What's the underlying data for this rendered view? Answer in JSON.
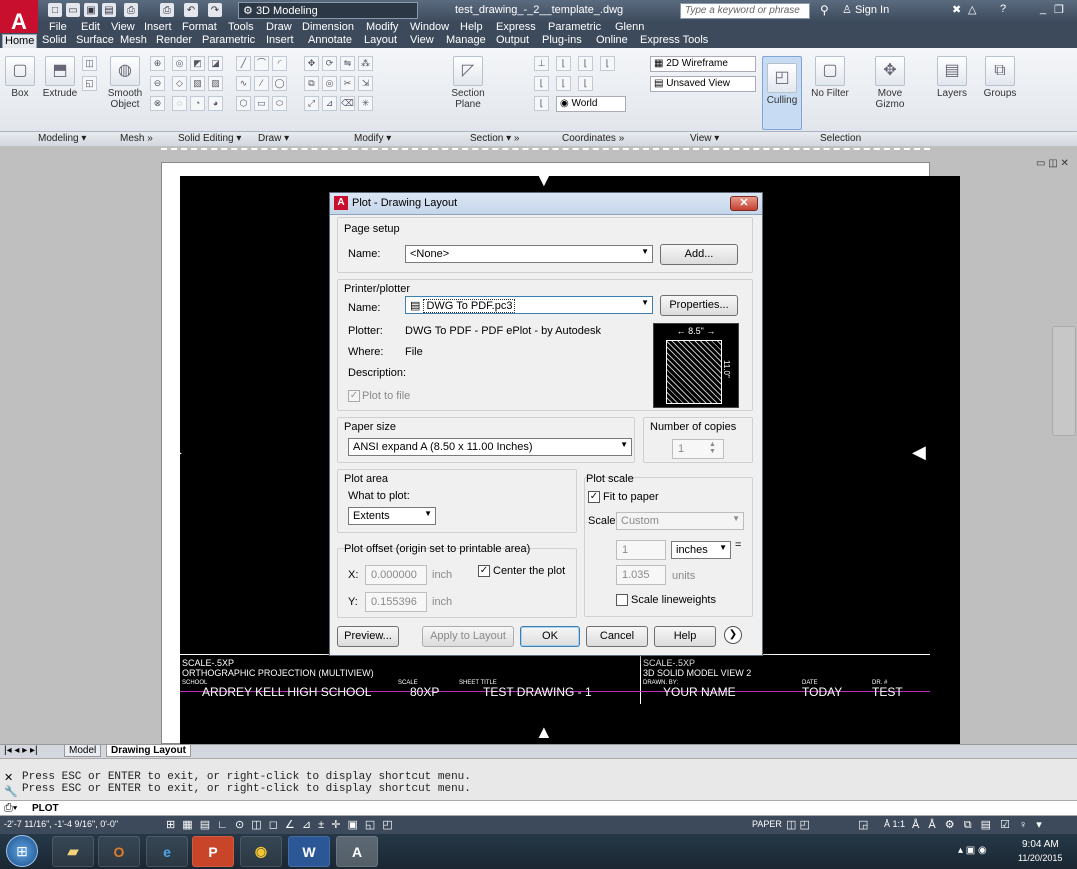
{
  "app": {
    "workspace": "3D Modeling",
    "document_title": "test_drawing_-_2__template_.dwg",
    "search_placeholder": "Type a keyword or phrase",
    "sign_in": "Sign In"
  },
  "menu": [
    "File",
    "Edit",
    "View",
    "Insert",
    "Format",
    "Tools",
    "Draw",
    "Dimension",
    "Modify",
    "Window",
    "Help",
    "Express",
    "Parametric",
    "Glenn"
  ],
  "ribbon_tabs": [
    "Home",
    "Solid",
    "Surface",
    "Mesh",
    "Render",
    "Parametric",
    "Insert",
    "Annotate",
    "Layout",
    "View",
    "Manage",
    "Output",
    "Plug-ins",
    "Online",
    "Express Tools"
  ],
  "ribbon": {
    "box": "Box",
    "extrude": "Extrude",
    "smooth_object": "Smooth Object",
    "section_plane": "Section Plane",
    "visual_style": "2D Wireframe",
    "view": "Unsaved View",
    "world": "World",
    "culling": "Culling",
    "no_filter": "No Filter",
    "move_gizmo": "Move Gizmo",
    "layers": "Layers",
    "groups": "Groups",
    "panels": [
      "Modeling",
      "Mesh",
      "Solid Editing",
      "Draw",
      "Modify",
      "Section",
      "Coordinates",
      "View",
      "Selection"
    ]
  },
  "titleblock": {
    "scale_left": "SCALE-.5XP",
    "title_left": "ORTHOGRAPHIC PROJECTION (MULTIVIEW)",
    "school_label": "SCHOOL",
    "school": "ARDREY KELL HIGH SCHOOL",
    "scale_label": "SCALE",
    "scale": "80XP",
    "sheet_title_label": "SHEET TITLE",
    "sheet_title": "TEST DRAWING - 1",
    "scale_right": "SCALE-.5XP",
    "title_right": "3D SOLID MODEL VIEW 2",
    "drawn_by_label": "DRAWN. BY:",
    "drawn_by": "YOUR NAME",
    "date_label": "DATE",
    "date": "TODAY",
    "dr_label": "DR. #",
    "dr": "TEST"
  },
  "layout_tabs": [
    "Model",
    "Drawing Layout"
  ],
  "command": {
    "line1": "Press ESC or ENTER to exit, or right-click to display shortcut menu.",
    "line2": "Press ESC or ENTER to exit, or right-click to display shortcut menu.",
    "prompt": "PLOT"
  },
  "status": {
    "coords": "-2'-7 11/16\", -1'-4 9/16\", 0'-0\"",
    "paper": "PAPER",
    "anno_scale": "1:1"
  },
  "taskbar": {
    "time": "9:04 AM",
    "date": "11/20/2015"
  },
  "dialog": {
    "title": "Plot - Drawing Layout",
    "page_setup": {
      "group": "Page setup",
      "name_label": "Name:",
      "name_value": "<None>",
      "add_button": "Add..."
    },
    "printer": {
      "group": "Printer/plotter",
      "name_label": "Name:",
      "name_value": "DWG To PDF.pc3",
      "properties_button": "Properties...",
      "plotter_label": "Plotter:",
      "plotter_value": "DWG To PDF - PDF ePlot - by Autodesk",
      "where_label": "Where:",
      "where_value": "File",
      "description_label": "Description:",
      "plot_to_file": "Plot to file",
      "plot_to_file_checked": true,
      "preview_width": "8.5\"",
      "preview_height": "11.0\""
    },
    "paper_size": {
      "group": "Paper size",
      "value": "ANSI expand A (8.50 x 11.00 Inches)"
    },
    "copies": {
      "group": "Number of copies",
      "value": "1"
    },
    "plot_area": {
      "group": "Plot area",
      "what_label": "What to plot:",
      "what_value": "Extents"
    },
    "plot_scale": {
      "group": "Plot scale",
      "fit_to_paper": "Fit to paper",
      "fit_checked": true,
      "scale_label": "Scale:",
      "scale_value": "Custom",
      "value1": "1",
      "unit1": "inches",
      "equals": "=",
      "value2": "1.035",
      "unit2": "units",
      "scale_lineweights": "Scale lineweights",
      "scale_lineweights_checked": false
    },
    "plot_offset": {
      "group": "Plot offset (origin set to printable area)",
      "x_label": "X:",
      "x_value": "0.000000",
      "x_unit": "inch",
      "center": "Center the plot",
      "center_checked": true,
      "y_label": "Y:",
      "y_value": "0.155396",
      "y_unit": "inch"
    },
    "buttons": {
      "preview": "Preview...",
      "apply": "Apply to Layout",
      "ok": "OK",
      "cancel": "Cancel",
      "help": "Help"
    }
  }
}
